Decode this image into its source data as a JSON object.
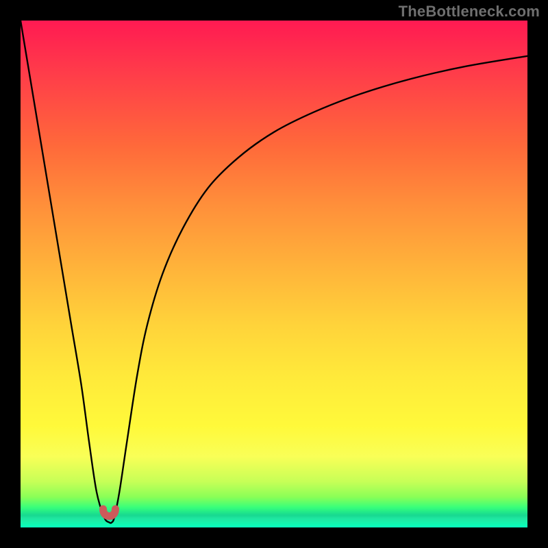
{
  "watermark": "TheBottleneck.com",
  "chart_data": {
    "type": "line",
    "title": "",
    "xlabel": "",
    "ylabel": "",
    "xlim": [
      0,
      100
    ],
    "ylim": [
      0,
      100
    ],
    "grid": false,
    "series": [
      {
        "name": "bottleneck-curve",
        "x": [
          0,
          2,
          4,
          6,
          8,
          10,
          12,
          13.5,
          15,
          16.5,
          17.5,
          18,
          18.5,
          19.5,
          21,
          23,
          25,
          28,
          32,
          37,
          43,
          50,
          58,
          67,
          77,
          88,
          100
        ],
        "values": [
          100,
          88,
          76,
          64,
          52,
          40,
          28,
          17,
          7,
          2,
          1,
          1,
          2,
          7,
          17,
          30,
          40,
          50,
          59,
          67,
          73,
          78,
          82,
          85.5,
          88.5,
          91,
          93
        ]
      }
    ],
    "annotations": {
      "minimum_marker": {
        "x_range": [
          16.0,
          19.0
        ],
        "style": "red-rounded-u"
      }
    },
    "background": {
      "type": "vertical-gradient",
      "stops": [
        {
          "pos": 0.0,
          "color": "#ff1a52"
        },
        {
          "pos": 0.25,
          "color": "#ff6a3a"
        },
        {
          "pos": 0.5,
          "color": "#ffb13a"
        },
        {
          "pos": 0.7,
          "color": "#ffe93a"
        },
        {
          "pos": 0.88,
          "color": "#ebff57"
        },
        {
          "pos": 1.0,
          "color": "#0affc0"
        }
      ]
    }
  },
  "colors": {
    "frame": "#000000",
    "curve": "#000000",
    "marker": "#cc5a5a",
    "watermark": "#6f6f6f"
  }
}
